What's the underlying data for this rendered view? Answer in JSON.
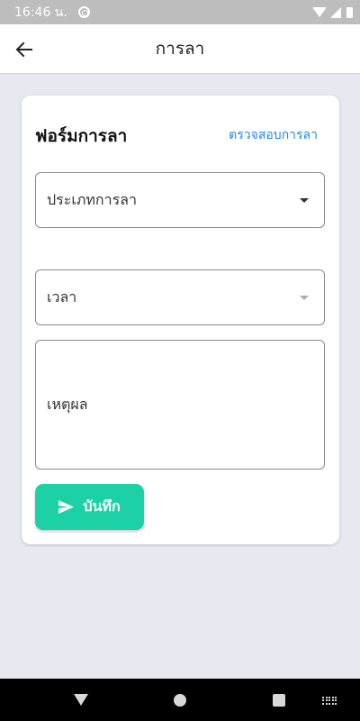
{
  "status_bar": {
    "time": "16:46 น."
  },
  "app_bar": {
    "title": "การลา"
  },
  "form": {
    "title": "ฟอร์มการลา",
    "check_link": "ตรวจสอบการลา",
    "leave_type_placeholder": "ประเภทการลา",
    "time_placeholder": "เวลา",
    "reason_placeholder": "เหตุผล",
    "save_label": "บันทึก"
  },
  "colors": {
    "accent": "#1bd1a5",
    "link": "#1e88e5",
    "background": "#e8e8f0"
  }
}
